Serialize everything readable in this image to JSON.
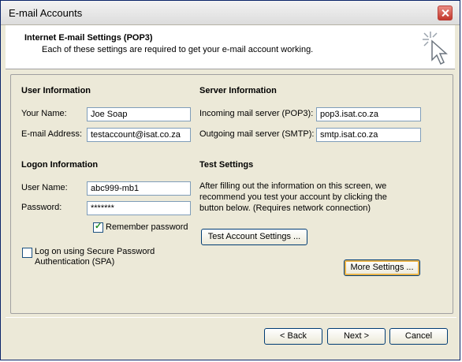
{
  "window": {
    "title": "E-mail Accounts"
  },
  "header": {
    "title": "Internet E-mail Settings (POP3)",
    "subtitle": "Each of these settings are required to get your e-mail account working."
  },
  "user_info": {
    "heading": "User Information",
    "your_name_label": "Your Name:",
    "your_name_value": "Joe Soap",
    "email_label": "E-mail Address:",
    "email_value": "testaccount@isat.co.za"
  },
  "logon_info": {
    "heading": "Logon Information",
    "user_name_label": "User Name:",
    "user_name_value": "abc999-mb1",
    "password_label": "Password:",
    "password_value": "*******",
    "remember_label": "Remember password",
    "remember_checked": true,
    "spa_label_line1": "Log on using Secure Password",
    "spa_label_line2": "Authentication (SPA)",
    "spa_checked": false
  },
  "server_info": {
    "heading": "Server Information",
    "incoming_label": "Incoming mail server (POP3):",
    "incoming_value": "pop3.isat.co.za",
    "outgoing_label": "Outgoing mail server (SMTP):",
    "outgoing_value": "smtp.isat.co.za"
  },
  "test_settings": {
    "heading": "Test Settings",
    "desc_line1": "After filling out the information on this screen, we",
    "desc_line2": "recommend you test your account by clicking the",
    "desc_line3": "button below. (Requires network connection)",
    "button_label": "Test Account Settings ..."
  },
  "more_settings_label": "More Settings ...",
  "footer": {
    "back_label": "< Back",
    "next_label": "Next >",
    "cancel_label": "Cancel"
  },
  "icons": {
    "close": "close-icon",
    "wizard": "cursor-sparkle-icon"
  }
}
